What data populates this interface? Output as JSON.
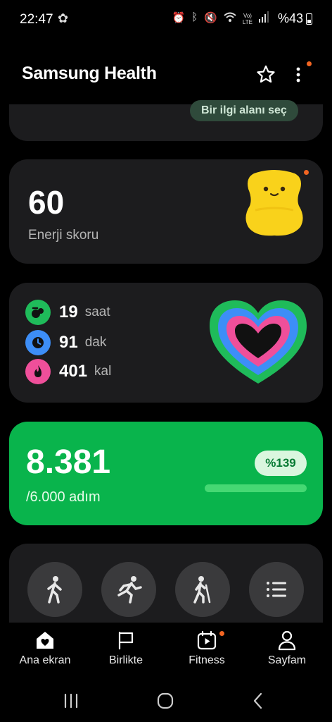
{
  "status_bar": {
    "time": "22:47",
    "battery": "%43",
    "signal_label": "LTE",
    "volte_label": "Vo)"
  },
  "header": {
    "title": "Samsung Health",
    "favorites_icon": "star-icon",
    "menu_icon": "more-vertical-icon"
  },
  "interests_card": {
    "chip_label": "Bir ilgi alanı seç"
  },
  "energy_card": {
    "value": "60",
    "label": "Enerji skoru"
  },
  "activity_card": {
    "rows": [
      {
        "value": "19",
        "unit": "saat",
        "icon": "active-time-icon",
        "color": "#1fbb5a"
      },
      {
        "value": "91",
        "unit": "dak",
        "icon": "clock-icon",
        "color": "#3d8ef7"
      },
      {
        "value": "401",
        "unit": "kal",
        "icon": "flame-icon",
        "color": "#ef4f9a"
      }
    ]
  },
  "steps_card": {
    "value": "8.381",
    "goal": "/6.000 adım",
    "percent": "%139",
    "progress": 1.0
  },
  "exercise_card": {
    "buttons": [
      {
        "icon": "walking-icon"
      },
      {
        "icon": "running-icon"
      },
      {
        "icon": "hiking-icon"
      },
      {
        "icon": "list-icon"
      }
    ]
  },
  "bottom_nav": {
    "items": [
      {
        "label": "Ana ekran",
        "icon": "home-heart-icon",
        "active": true
      },
      {
        "label": "Birlikte",
        "icon": "flag-icon",
        "active": false
      },
      {
        "label": "Fitness",
        "icon": "calendar-play-icon",
        "active": false,
        "badge": true
      },
      {
        "label": "Sayfam",
        "icon": "person-icon",
        "active": false
      }
    ]
  },
  "colors": {
    "accent_green": "#09b44c",
    "notification_dot": "#f26522",
    "card_bg": "#1c1c1e"
  }
}
